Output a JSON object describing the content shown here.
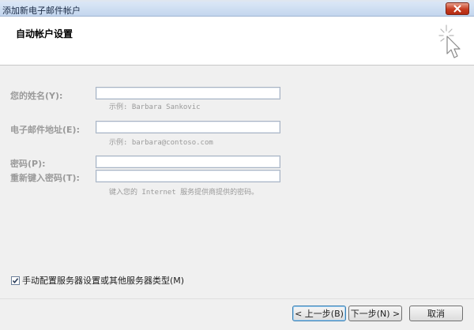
{
  "window": {
    "title": "添加新电子邮件帐户"
  },
  "header": {
    "heading": "自动帐户设置"
  },
  "form": {
    "name_label": "您的姓名(Y):",
    "name_value": "",
    "name_hint": "示例: Barbara Sankovic",
    "email_label": "电子邮件地址(E):",
    "email_value": "",
    "email_hint": "示例: barbara@contoso.com",
    "password_label": "密码(P):",
    "password_value": "",
    "password_confirm_label": "重新键入密码(T):",
    "password_confirm_value": "",
    "password_hint": "键入您的 Internet 服务提供商提供的密码。",
    "manual_config_label": "手动配置服务器设置或其他服务器类型(M)",
    "manual_config_checked": true
  },
  "footer": {
    "back_label": "< 上一步(B)",
    "next_label": "下一步(N) >",
    "cancel_label": "取消"
  },
  "icons": {
    "close": "close-icon",
    "wizard": "cursor-click-icon",
    "check": "checkmark-icon"
  },
  "colors": {
    "close_button": "#c63b20",
    "disabled_text": "#9a9a9a",
    "header_bg": "#ffffff",
    "body_bg": "#f0f0f0"
  }
}
